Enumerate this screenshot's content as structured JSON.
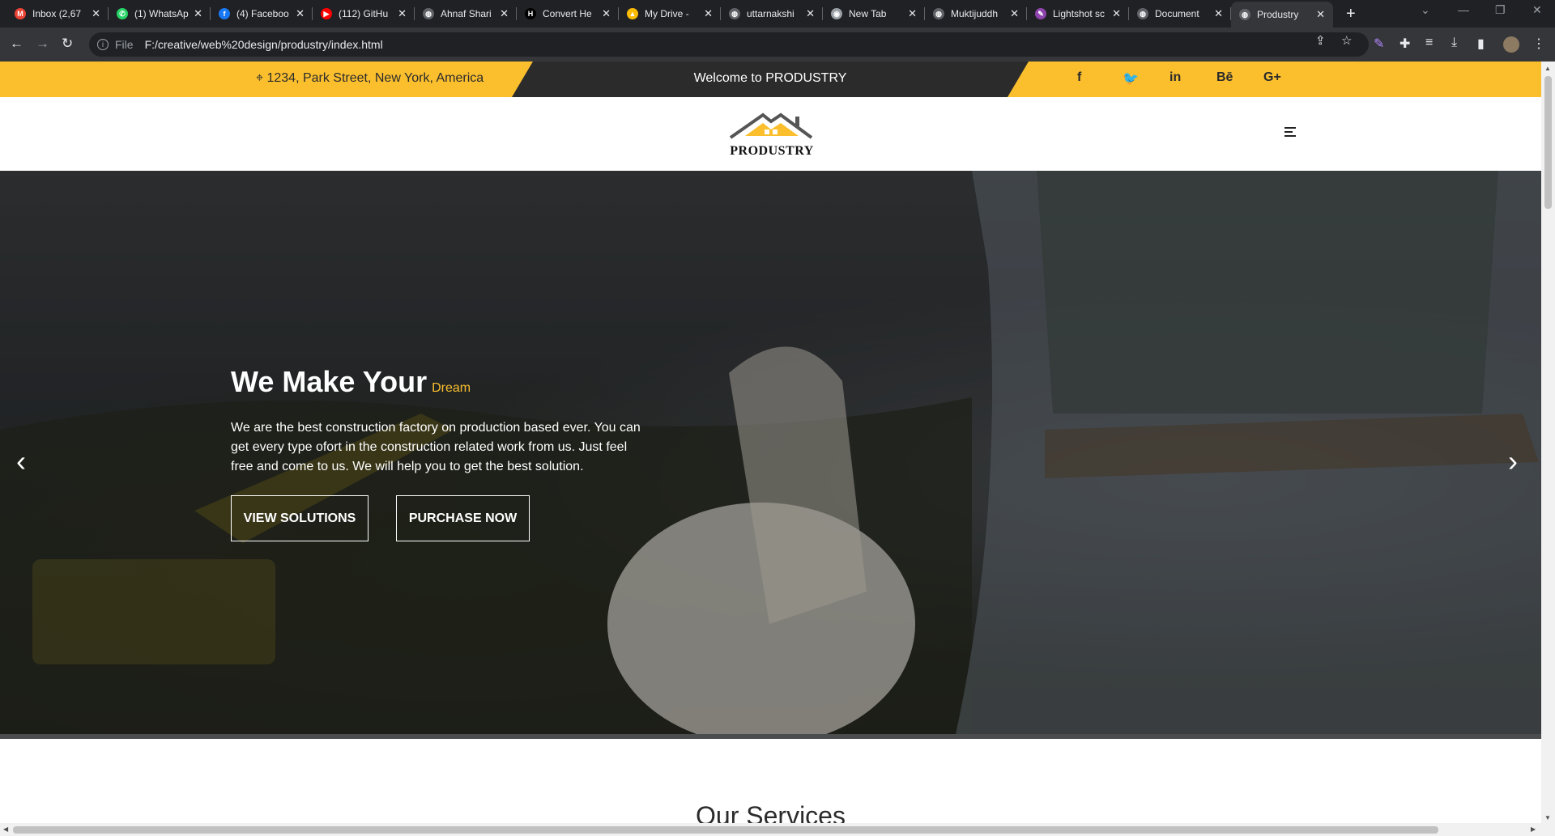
{
  "browser": {
    "tabs": [
      {
        "title": "Inbox (2,67",
        "icon": "gmail-icon",
        "color": "#ea4335",
        "glyph": "M"
      },
      {
        "title": "(1) WhatsAp",
        "icon": "whatsapp-icon",
        "color": "#25d366",
        "glyph": "✆"
      },
      {
        "title": "(4) Faceboo",
        "icon": "facebook-icon",
        "color": "#1877f2",
        "glyph": "f"
      },
      {
        "title": "(112) GitHu",
        "icon": "youtube-icon",
        "color": "#ff0000",
        "glyph": "▶"
      },
      {
        "title": "Ahnaf Shari",
        "icon": "globe-icon",
        "color": "#5f6368",
        "glyph": "◍"
      },
      {
        "title": "Convert He",
        "icon": "h-logo-icon",
        "color": "#000000",
        "glyph": "H"
      },
      {
        "title": "My Drive - ",
        "icon": "google-drive-icon",
        "color": "#fbbc04",
        "glyph": "▲"
      },
      {
        "title": "uttarnakshi",
        "icon": "globe-icon",
        "color": "#5f6368",
        "glyph": "◍"
      },
      {
        "title": "New Tab",
        "icon": "chrome-icon",
        "color": "#9aa0a6",
        "glyph": "◉"
      },
      {
        "title": "Muktijuddh",
        "icon": "globe-icon",
        "color": "#5f6368",
        "glyph": "◍"
      },
      {
        "title": "Lightshot sc",
        "icon": "lightshot-icon",
        "color": "#8e44ad",
        "glyph": "✎"
      },
      {
        "title": "Document",
        "icon": "globe-icon",
        "color": "#5f6368",
        "glyph": "◍"
      },
      {
        "title": "Produstry",
        "icon": "globe-icon",
        "color": "#5f6368",
        "glyph": "◍",
        "active": true
      }
    ],
    "url_scheme": "File",
    "url": "F:/creative/web%20design/produstry/index.html"
  },
  "topbar": {
    "address": "1234, Park Street, New York, America",
    "welcome": "Welcome to PRODUSTRY",
    "social": [
      {
        "name": "facebook-icon",
        "glyph": "f"
      },
      {
        "name": "twitter-icon",
        "glyph": "🐦"
      },
      {
        "name": "linkedin-icon",
        "glyph": "in"
      },
      {
        "name": "behance-icon",
        "glyph": "Bē"
      },
      {
        "name": "google-plus-icon",
        "glyph": "G+"
      }
    ]
  },
  "brand": {
    "logo_text": "PRODUSTRY"
  },
  "hero": {
    "heading": "We Make Your",
    "highlight": "Dream",
    "paragraph": "We are the best construction factory on production based ever. You can get every type ofort in the construction related work from us. Just feel free and come to us. We will help you to get the best solution.",
    "btn_primary": "VIEW SOLUTIONS",
    "btn_secondary": "PURCHASE NOW"
  },
  "services": {
    "title": "Our Services"
  },
  "colors": {
    "accent": "#fbbf2e",
    "dark": "#2b2b2b"
  }
}
